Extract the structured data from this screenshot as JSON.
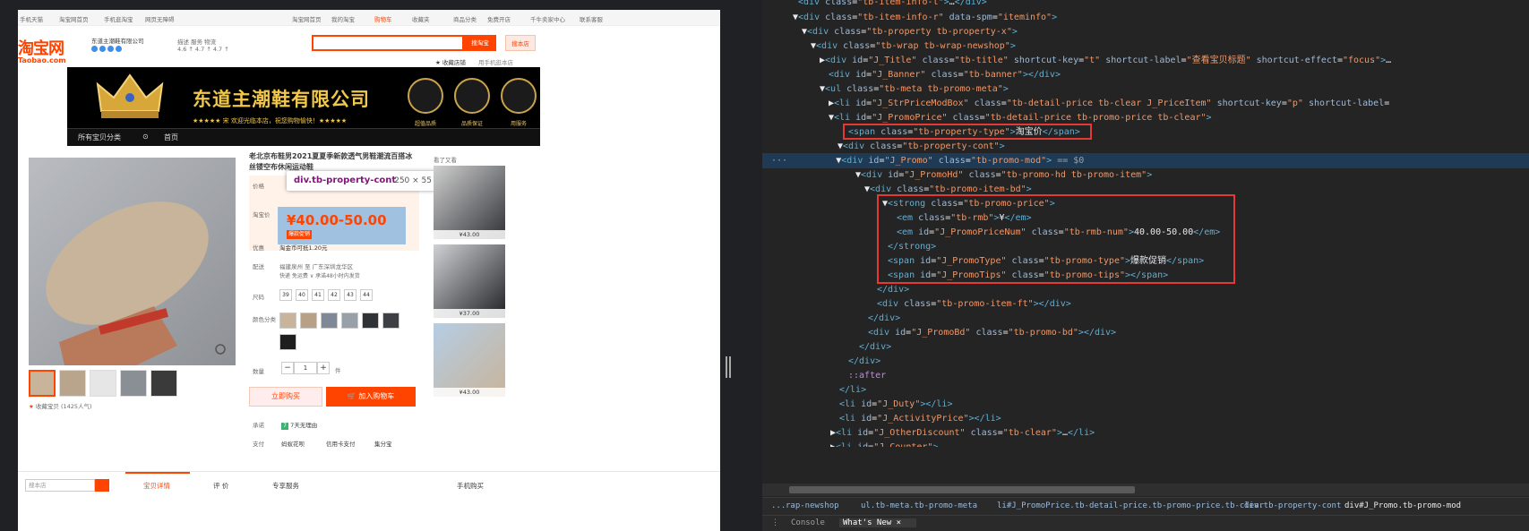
{
  "topbar": {
    "items": [
      "手机天猫",
      "淘宝网首页",
      "手机逛淘宝",
      "网页无障碍",
      "淘宝网首页",
      "我的淘宝",
      "购物车",
      "收藏夹",
      "商品分类",
      "免费开店",
      "千牛卖家中心",
      "联系客服"
    ]
  },
  "header": {
    "logo_cn": "淘宝网",
    "logo_en": "Taobao.com",
    "shop_name": "东道主潮鞋有限公司",
    "ratings_label": "描述 服务 物流",
    "ratings_values": "4.6 ↑ 4.7 ↑ 4.7 ↑",
    "search_placeholder": "",
    "search_taobao": "搜淘宝",
    "search_shop": "搜本店",
    "fav_shop": "收藏店铺",
    "mobile_shop": "用手机逛本店"
  },
  "banner": {
    "title": "东道主潮鞋有限公司",
    "subtitle": "★★★★★ 宋 欢迎光临本店，祝您购物愉快！★★★★★",
    "badges": [
      "超值品质",
      "品质保证",
      "用服务"
    ],
    "nav": [
      "所有宝贝分类",
      "首页"
    ]
  },
  "product": {
    "title": "老北京布鞋男2021夏夏季新款透气男鞋潮流百搭冰丝镂空布休闲运动鞋",
    "price_label": "价格",
    "taobao_price_label": "淘宝价",
    "price": "¥40.00-50.00",
    "promo_type": "爆款促销",
    "offer_label": "优惠",
    "offer_text": "淘金币可抵1.20元",
    "ship_label": "配送",
    "ship_from": "福建泉州 至 广东深圳龙华区",
    "ship_fee": "快递 免运费 ∨ 承诺48小时内发货",
    "size_label": "尺码",
    "sizes": [
      "39",
      "40",
      "41",
      "42",
      "43",
      "44"
    ],
    "color_label": "颜色分类",
    "qty_label": "数量",
    "qty_value": "1",
    "qty_unit": "件",
    "buy_now": "立即购买",
    "add_cart": "加入购物车",
    "fav": "收藏宝贝 (1425人气)",
    "commit_label": "承诺",
    "commit_text": "7天无理由",
    "pay_label": "支付",
    "pay_methods": [
      "蚂蚁花呗",
      "信用卡支付",
      "集分宝"
    ]
  },
  "tooltip": {
    "selector": "div.tb-property-cont",
    "size": "250 × 55"
  },
  "recommend": {
    "title": "看了又看",
    "prices": [
      "¥43.00",
      "¥37.00",
      "¥43.00"
    ]
  },
  "tabs": {
    "search_placeholder": "搜本店",
    "items": [
      "宝贝详情",
      "评 价",
      "专享服务",
      "手机购买"
    ]
  },
  "devtools": {
    "selected_suffix": "== $0",
    "after": "::after",
    "breadcrumb": [
      "...",
      "rap-newshop",
      "ul.tb-meta.tb-promo-meta",
      "li#J_PromoPrice.tb-detail-price.tb-promo-price.tb-clear",
      "div.tb-property-cont",
      "div#J_Promo.tb-promo-mod"
    ],
    "bottom_tabs": [
      "Console",
      "What's New"
    ]
  }
}
